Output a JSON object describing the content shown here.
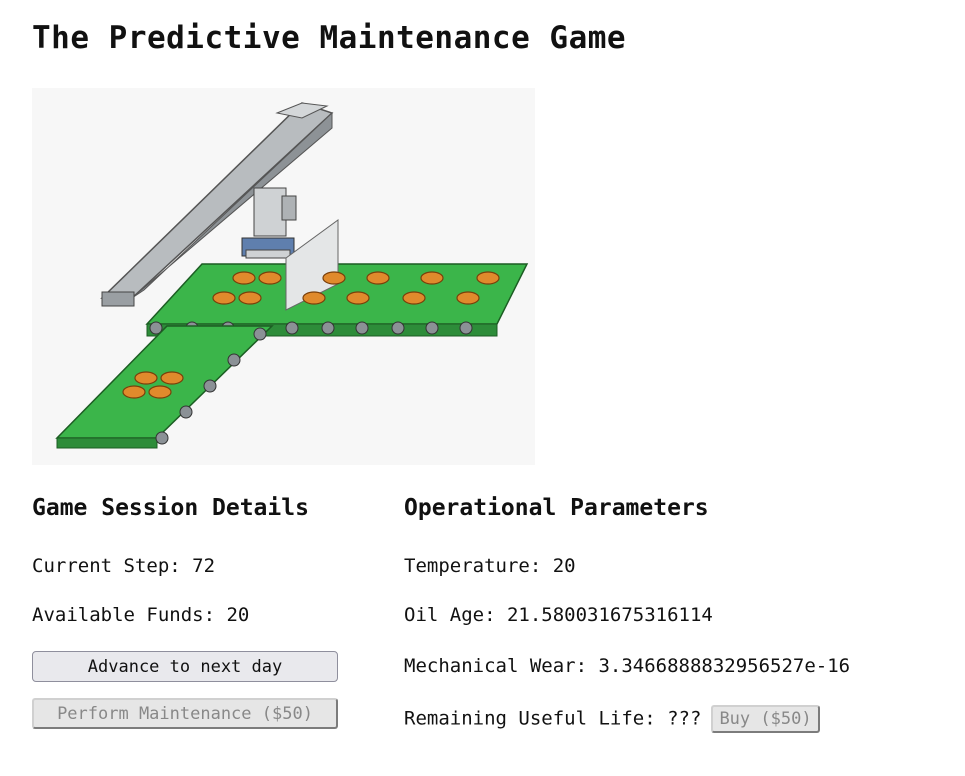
{
  "title": "The Predictive Maintenance Game",
  "scene": {
    "icon": "conveyor-gantry-illustration"
  },
  "session": {
    "heading": "Game Session Details",
    "step_label": "Current Step: ",
    "step_value": "72",
    "funds_label": "Available Funds: ",
    "funds_value": "20",
    "advance_label": "Advance to next day",
    "maintenance_label": "Perform Maintenance ($50)"
  },
  "params": {
    "heading": "Operational Parameters",
    "temperature_label": "Temperature: ",
    "temperature_value": "20",
    "oil_label": "Oil Age: ",
    "oil_value": "21.580031675316114",
    "wear_label": "Mechanical Wear: ",
    "wear_value": "3.3466888832956527e-16",
    "rul_label": "Remaining Useful Life: ",
    "rul_value": "???",
    "buy_label": "Buy ($50)"
  }
}
